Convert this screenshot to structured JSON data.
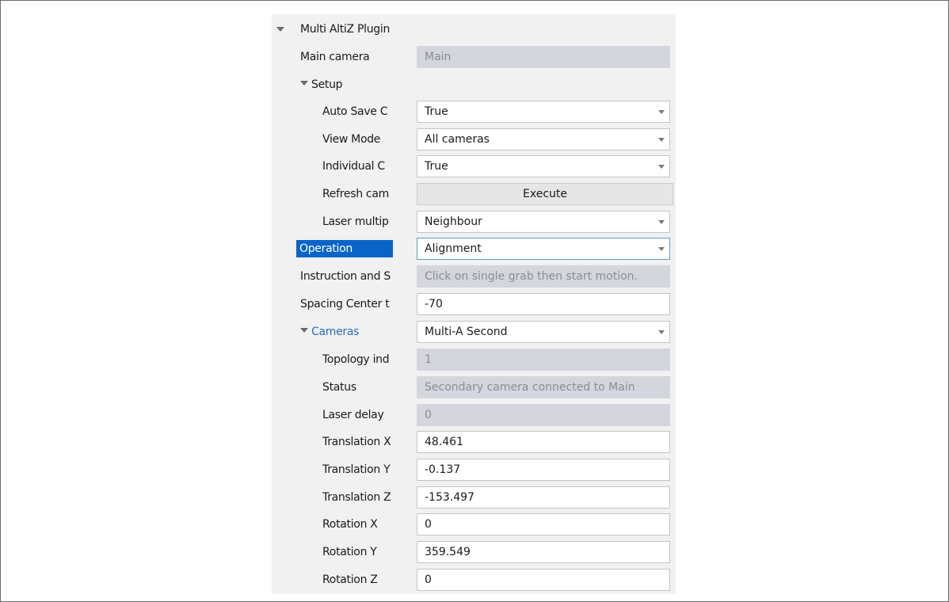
{
  "plugin": {
    "title": "Multi AltiZ Plugin"
  },
  "rows": {
    "main_camera": {
      "label": "Main camera",
      "value": "Main"
    },
    "setup": {
      "label": "Setup"
    },
    "auto_save": {
      "label": "Auto Save C",
      "value": "True"
    },
    "view_mode": {
      "label": "View Mode",
      "value": "All cameras"
    },
    "individual": {
      "label": "Individual C",
      "value": "True"
    },
    "refresh": {
      "label": "Refresh cam",
      "button": "Execute"
    },
    "laser_multip": {
      "label": "Laser multip",
      "value": "Neighbour"
    },
    "operation": {
      "label": "Operation",
      "value": "Alignment"
    },
    "instruction": {
      "label": "Instruction and S",
      "value": "Click on single grab then start motion."
    },
    "spacing": {
      "label": "Spacing Center t",
      "value": "-70"
    },
    "cameras": {
      "label": "Cameras",
      "value": "Multi-A Second"
    },
    "topology": {
      "label": "Topology ind",
      "value": "1"
    },
    "status": {
      "label": "Status",
      "value": "Secondary camera connected to Main"
    },
    "laser_delay": {
      "label": "Laser delay",
      "value": "0"
    },
    "translation_x": {
      "label": "Translation X",
      "value": "48.461"
    },
    "translation_y": {
      "label": "Translation Y",
      "value": "-0.137"
    },
    "translation_z": {
      "label": "Translation Z",
      "value": "-153.497"
    },
    "rotation_x": {
      "label": "Rotation X",
      "value": "0"
    },
    "rotation_y": {
      "label": "Rotation Y",
      "value": "359.549"
    },
    "rotation_z": {
      "label": "Rotation Z",
      "value": "0"
    }
  },
  "colors": {
    "selection": "#0a64c8",
    "readonly_bg": "#d3d6dc",
    "link": "#2a6fb5",
    "panel_bg": "#f1f1f1"
  },
  "icons": {
    "expand": "caret-down-icon",
    "dropdown": "chevron-down-icon"
  }
}
